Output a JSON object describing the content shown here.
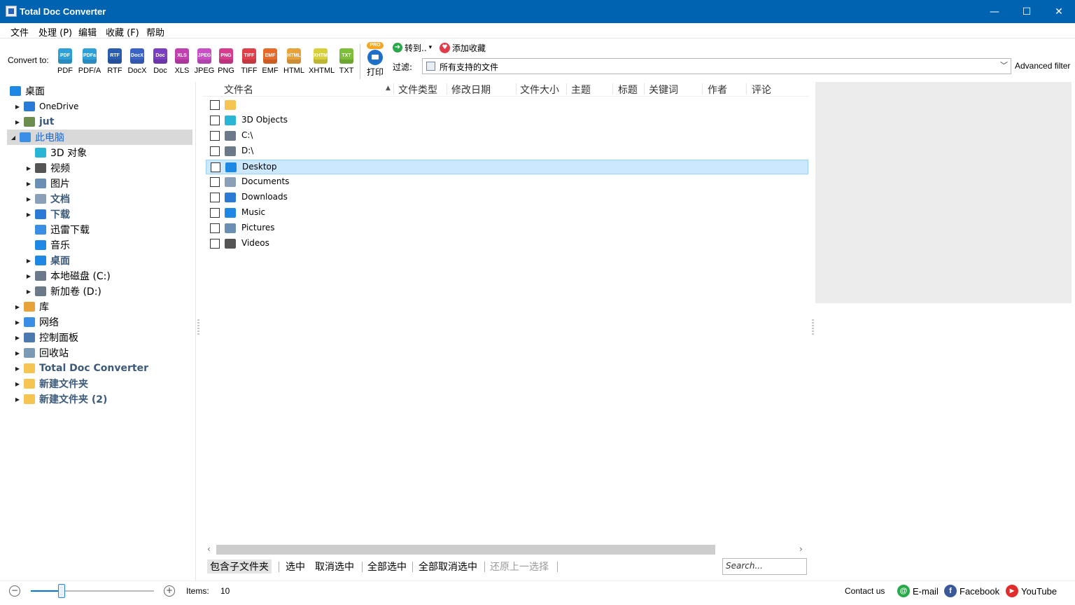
{
  "window": {
    "title": "Total Doc Converter",
    "min": "—",
    "max": "☐",
    "close": "✕"
  },
  "menu": [
    {
      "label": "文件"
    },
    {
      "label": "处理 (P)"
    },
    {
      "label": "编辑"
    },
    {
      "label": "收藏 (F)"
    },
    {
      "label": "帮助"
    }
  ],
  "toolbar": {
    "convert_to": "Convert to:",
    "formats": [
      {
        "label": "PDF",
        "icon_text": "PDF",
        "color": "#2f9fd8"
      },
      {
        "label": "PDF/A",
        "icon_text": "PDFa",
        "color": "#2f9fd8"
      },
      {
        "label": "RTF",
        "icon_text": "RTF",
        "color": "#2a5db0"
      },
      {
        "label": "DocX",
        "icon_text": "DocX",
        "color": "#3a63c4"
      },
      {
        "label": "Doc",
        "icon_text": "Doc",
        "color": "#7a3fc0"
      },
      {
        "label": "XLS",
        "icon_text": "XLS",
        "color": "#c23fb0"
      },
      {
        "label": "JPEG",
        "icon_text": "JPEG",
        "color": "#c84fc4"
      },
      {
        "label": "PNG",
        "icon_text": "PNG",
        "color": "#d63b8c"
      },
      {
        "label": "TIFF",
        "icon_text": "TIFF",
        "color": "#e0404a"
      },
      {
        "label": "EMF",
        "icon_text": "EMF",
        "color": "#e86a2a"
      },
      {
        "label": "HTML",
        "icon_text": "HTML",
        "color": "#e8a23a"
      },
      {
        "label": "XHTML",
        "icon_text": "XHTML",
        "color": "#d8d03a"
      },
      {
        "label": "TXT",
        "icon_text": "TXT",
        "color": "#7dbf3a"
      }
    ],
    "pro_badge": "PRO",
    "print": "打印",
    "goto": "转到..",
    "goto_arrow": "▾",
    "add_favorite": "添加收藏",
    "filter_label": "过滤:",
    "filter_value": "所有支持的文件",
    "filter_arrow": "﹀",
    "advanced_filter": "Advanced filter"
  },
  "tree": [
    {
      "label": "桌面",
      "style": "",
      "twisty": "",
      "icon": "desktop-icon",
      "color": "#1e88e5"
    },
    {
      "label": "OneDrive",
      "style": "sm",
      "twisty": "▶",
      "icon": "cloud-icon",
      "color": "#2b7bd6"
    },
    {
      "label": "jut",
      "style": "bold",
      "twisty": "▶",
      "icon": "user-icon",
      "color": "#6b8e4e"
    },
    {
      "label": "此电脑",
      "style": "blue",
      "twisty": "◢",
      "icon": "computer-icon",
      "color": "#3a8ee6"
    },
    {
      "label": "3D 对象",
      "style": "",
      "twisty": "",
      "icon": "cube-icon",
      "color": "#29b6d6"
    },
    {
      "label": "视频",
      "style": "",
      "twisty": "▶",
      "icon": "film-icon",
      "color": "#555555"
    },
    {
      "label": "图片",
      "style": "",
      "twisty": "▶",
      "icon": "picture-icon",
      "color": "#6a8fb5"
    },
    {
      "label": "文档",
      "style": "bold",
      "twisty": "▶",
      "icon": "document-icon",
      "color": "#8aa0b8"
    },
    {
      "label": "下载",
      "style": "bold",
      "twisty": "▶",
      "icon": "download-icon",
      "color": "#2b7bd6"
    },
    {
      "label": "迅雷下载",
      "style": "",
      "twisty": "",
      "icon": "thunder-icon",
      "color": "#3a8ee6"
    },
    {
      "label": "音乐",
      "style": "",
      "twisty": "",
      "icon": "music-icon",
      "color": "#1e88e5"
    },
    {
      "label": "桌面",
      "style": "bold",
      "twisty": "▶",
      "icon": "desktop-icon",
      "color": "#1e88e5"
    },
    {
      "label": "本地磁盘 (C:)",
      "style": "",
      "twisty": "▶",
      "icon": "drive-c-icon",
      "color": "#6a7a8a"
    },
    {
      "label": "新加卷 (D:)",
      "style": "",
      "twisty": "▶",
      "icon": "drive-icon",
      "color": "#6a7a8a"
    },
    {
      "label": "库",
      "style": "",
      "twisty": "▶",
      "icon": "library-icon",
      "color": "#e8a23a"
    },
    {
      "label": "网络",
      "style": "",
      "twisty": "▶",
      "icon": "network-icon",
      "color": "#3a8ee6"
    },
    {
      "label": "控制面板",
      "style": "",
      "twisty": "▶",
      "icon": "control-panel-icon",
      "color": "#4a7ab0"
    },
    {
      "label": "回收站",
      "style": "",
      "twisty": "▶",
      "icon": "recycle-bin-icon",
      "color": "#7a9ab8"
    },
    {
      "label": "Total Doc Converter",
      "style": "bold",
      "twisty": "▶",
      "icon": "folder-icon",
      "color": "#f5c451"
    },
    {
      "label": "新建文件夹",
      "style": "bold",
      "twisty": "▶",
      "icon": "folder-icon",
      "color": "#f5c451"
    },
    {
      "label": "新建文件夹 (2)",
      "style": "bold",
      "twisty": "▶",
      "icon": "folder-icon",
      "color": "#f5c451"
    }
  ],
  "list": {
    "sort_arrow": "▲",
    "columns": [
      {
        "label": "文件名"
      },
      {
        "label": "文件类型"
      },
      {
        "label": "修改日期"
      },
      {
        "label": "文件大小"
      },
      {
        "label": "主题"
      },
      {
        "label": "标题"
      },
      {
        "label": "关键词"
      },
      {
        "label": "作者"
      },
      {
        "label": "评论"
      }
    ],
    "rows": [
      {
        "name": "",
        "icon": "folder-icon",
        "color": "#f5c451"
      },
      {
        "name": "3D Objects",
        "icon": "cube-icon",
        "color": "#29b6d6"
      },
      {
        "name": "C:\\",
        "icon": "drive-c-icon",
        "color": "#6a7a8a"
      },
      {
        "name": "D:\\",
        "icon": "drive-icon",
        "color": "#6a7a8a"
      },
      {
        "name": "Desktop",
        "icon": "desktop-icon",
        "color": "#1e88e5"
      },
      {
        "name": "Documents",
        "icon": "document-icon",
        "color": "#8aa0b8"
      },
      {
        "name": "Downloads",
        "icon": "download-icon",
        "color": "#2b7bd6"
      },
      {
        "name": "Music",
        "icon": "music-icon",
        "color": "#1e88e5"
      },
      {
        "name": "Pictures",
        "icon": "picture-icon",
        "color": "#6a8fb5"
      },
      {
        "name": "Videos",
        "icon": "film-icon",
        "color": "#555555"
      }
    ]
  },
  "scroll": {
    "left": "‹",
    "right": "›"
  },
  "bottom_actions": {
    "include_subfolders": "包含子文件夹",
    "select": "选中",
    "deselect": "取消选中",
    "select_all": "全部选中",
    "deselect_all": "全部取消选中",
    "restore_selection": "还原上一选择",
    "search_placeholder": "Search..."
  },
  "status": {
    "zoom_minus": "−",
    "zoom_plus": "+",
    "zoom_level": 0.25,
    "items_label": "Items:",
    "items_count": "10",
    "contact": "Contact us",
    "email": "E-mail",
    "email_glyph": "@",
    "facebook": "Facebook",
    "facebook_glyph": "f",
    "youtube": "YouTube",
    "youtube_glyph": "▶"
  },
  "colors": {
    "titlebar": "#0063b1",
    "selection": "#cce8ff",
    "tree_selection": "#d9d9d9"
  }
}
